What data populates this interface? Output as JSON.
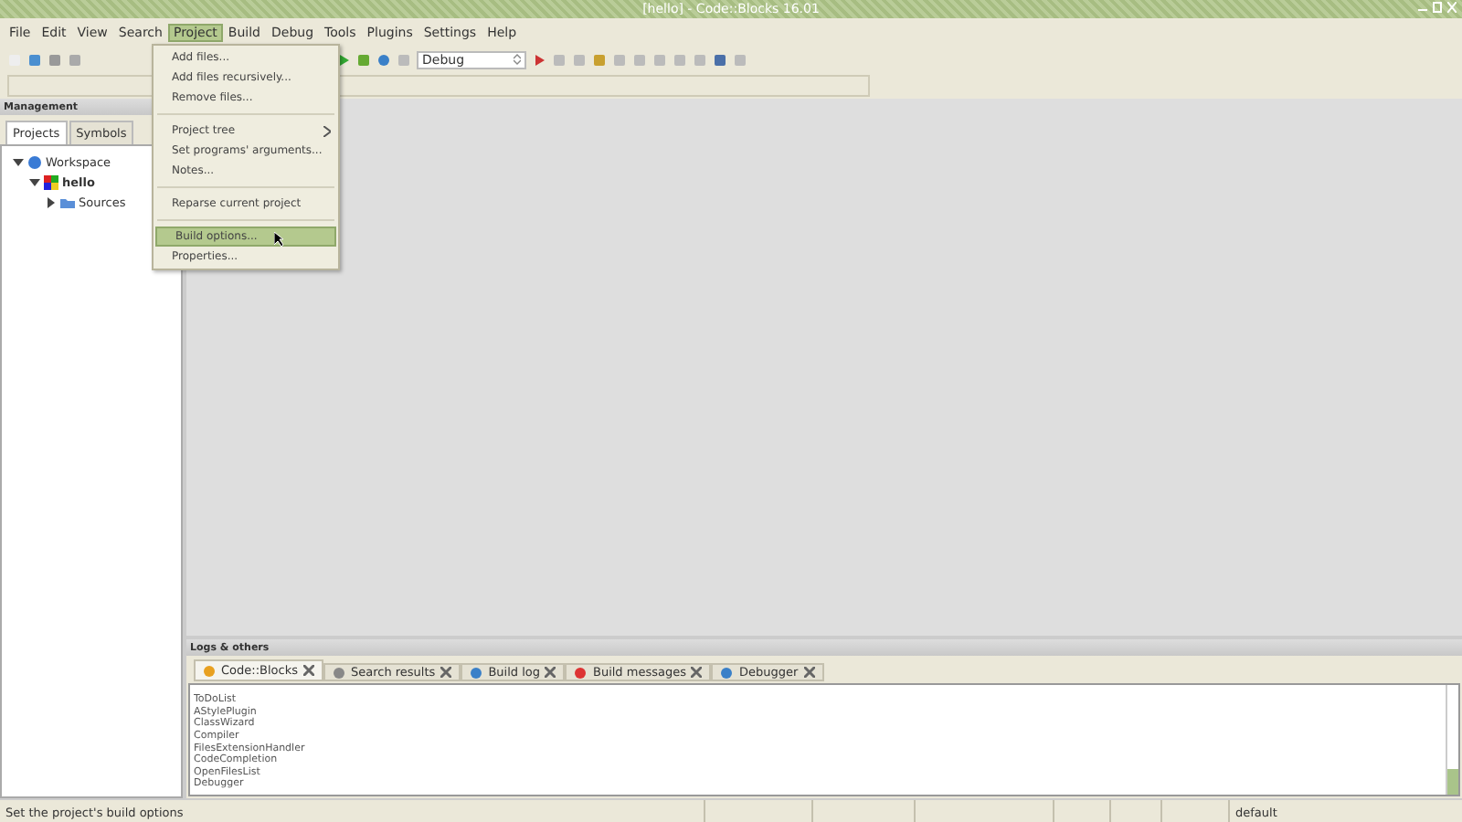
{
  "window": {
    "title": "[hello] - Code::Blocks 16.01"
  },
  "menu_bar": [
    {
      "label": "File",
      "selected": false
    },
    {
      "label": "Edit",
      "selected": false
    },
    {
      "label": "View",
      "selected": false
    },
    {
      "label": "Search",
      "selected": false
    },
    {
      "label": "Project",
      "selected": true
    },
    {
      "label": "Build",
      "selected": false
    },
    {
      "label": "Debug",
      "selected": false
    },
    {
      "label": "Tools",
      "selected": false
    },
    {
      "label": "Plugins",
      "selected": false
    },
    {
      "label": "Settings",
      "selected": false
    },
    {
      "label": "Help",
      "selected": false
    }
  ],
  "build_target": {
    "value": "Debug"
  },
  "project_menu": [
    {
      "kind": "item",
      "label": "Add files...",
      "selected": false
    },
    {
      "kind": "item",
      "label": "Add files recursively...",
      "selected": false
    },
    {
      "kind": "item",
      "label": "Remove files...",
      "selected": false
    },
    {
      "kind": "separator"
    },
    {
      "kind": "submenu",
      "label": "Project tree",
      "selected": false
    },
    {
      "kind": "item",
      "label": "Set programs' arguments...",
      "selected": false
    },
    {
      "kind": "item",
      "label": "Notes...",
      "selected": false
    },
    {
      "kind": "separator"
    },
    {
      "kind": "item",
      "label": "Reparse current project",
      "selected": false
    },
    {
      "kind": "separator"
    },
    {
      "kind": "item",
      "label": "Build options...",
      "selected": true
    },
    {
      "kind": "item",
      "label": "Properties...",
      "selected": false
    }
  ],
  "management": {
    "title": "Management",
    "tabs": [
      {
        "label": "Projects",
        "selected": true
      },
      {
        "label": "Symbols",
        "selected": false
      }
    ],
    "tree": [
      {
        "label": "Workspace",
        "expanded": true,
        "children": [
          {
            "label": "hello",
            "expanded": true,
            "children": [
              {
                "label": "Sources",
                "expanded": false
              }
            ]
          }
        ]
      }
    ]
  },
  "logs": {
    "title": "Logs & others",
    "tabs": [
      {
        "label": "Code::Blocks",
        "selected": true
      },
      {
        "label": "Search results",
        "selected": false
      },
      {
        "label": "Build log",
        "selected": false
      },
      {
        "label": "Build messages",
        "selected": false
      },
      {
        "label": "Debugger",
        "selected": false
      }
    ],
    "lines": [
      "ToDoList",
      "AStylePlugin",
      "ClassWizard",
      "Compiler",
      "FilesExtensionHandler",
      "CodeCompletion",
      "OpenFilesList",
      "Debugger"
    ]
  },
  "status_bar": {
    "message": "Set the project's build options",
    "profile": "default"
  }
}
